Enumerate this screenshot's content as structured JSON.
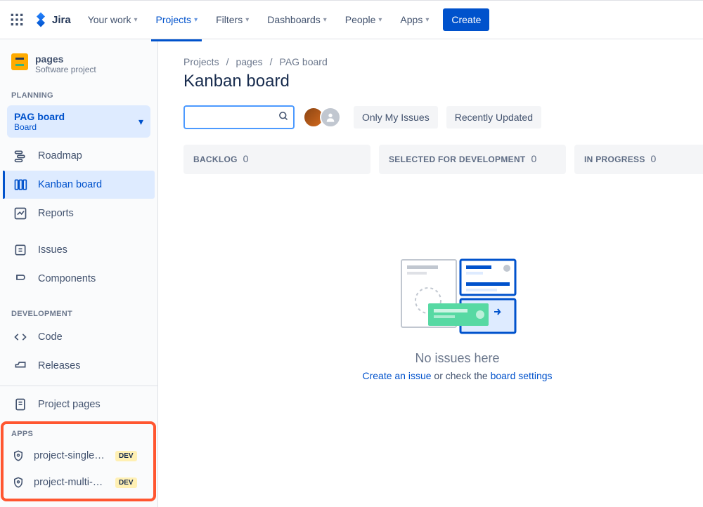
{
  "topnav": {
    "brand": "Jira",
    "items": [
      "Your work",
      "Projects",
      "Filters",
      "Dashboards",
      "People",
      "Apps"
    ],
    "create": "Create"
  },
  "sidebar": {
    "project": {
      "name": "pages",
      "type": "Software project"
    },
    "sections": {
      "planning": "PLANNING",
      "development": "DEVELOPMENT",
      "apps": "APPS"
    },
    "board_selector": {
      "name": "PAG board",
      "sub": "Board"
    },
    "planning_items": [
      {
        "label": "Roadmap",
        "icon": "roadmap"
      },
      {
        "label": "Kanban board",
        "icon": "board"
      },
      {
        "label": "Reports",
        "icon": "reports"
      }
    ],
    "other_items": [
      {
        "label": "Issues",
        "icon": "issues"
      },
      {
        "label": "Components",
        "icon": "components"
      }
    ],
    "dev_items": [
      {
        "label": "Code",
        "icon": "code"
      },
      {
        "label": "Releases",
        "icon": "releases"
      }
    ],
    "pages_item": {
      "label": "Project pages",
      "icon": "page"
    },
    "apps_items": [
      {
        "label": "project-single-page-app",
        "badge": "DEV"
      },
      {
        "label": "project-multi-page-app",
        "badge": "DEV"
      }
    ]
  },
  "main": {
    "breadcrumb": [
      "Projects",
      "pages",
      "PAG board"
    ],
    "title": "Kanban board",
    "search_placeholder": "",
    "filters": [
      "Only My Issues",
      "Recently Updated"
    ],
    "columns": [
      {
        "name": "BACKLOG",
        "count": "0"
      },
      {
        "name": "SELECTED FOR DEVELOPMENT",
        "count": "0"
      },
      {
        "name": "IN PROGRESS",
        "count": "0"
      }
    ],
    "empty": {
      "title": "No issues here",
      "create_link": "Create an issue",
      "middle": " or check the ",
      "settings_link": "board settings"
    }
  }
}
